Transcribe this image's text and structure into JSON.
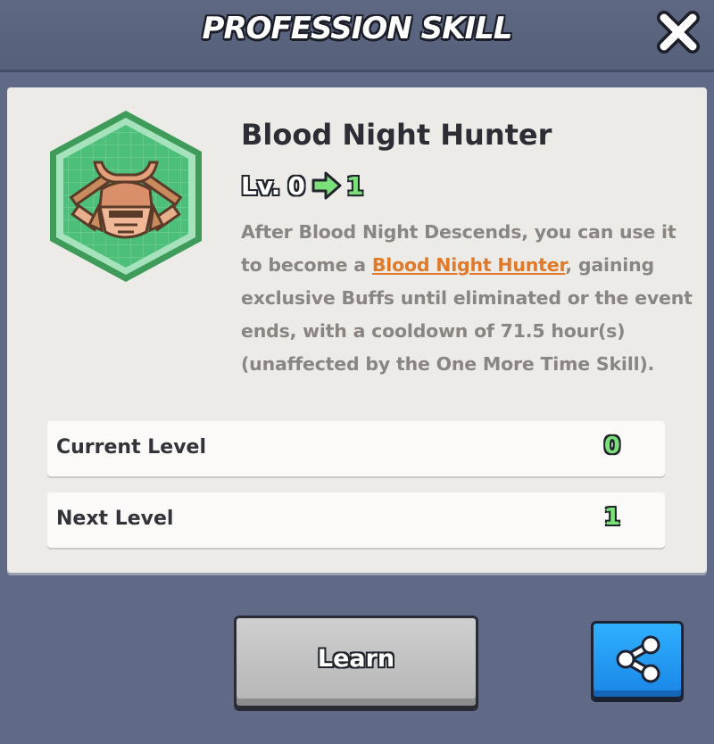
{
  "header": {
    "title": "PROFESSION SKILL",
    "close_icon": "close-icon"
  },
  "skill": {
    "icon": "samurai-helmet-icon",
    "name": "Blood Night Hunter",
    "level_prefix": "Lv.",
    "level_current": "0",
    "level_next": "1",
    "description_part1": "After Blood Night Descends, you can use it to become a ",
    "description_link": "Blood Night Hunter",
    "description_part2": ", gaining exclusive Buffs until eliminated or the event ends, with a cooldown of 71.5 hour(s) (unaffected by the One More Time Skill)."
  },
  "rows": [
    {
      "label": "Current Level",
      "value": "0"
    },
    {
      "label": "Next Level",
      "value": "1"
    }
  ],
  "actions": {
    "learn_label": "Learn",
    "share_icon": "share-icon"
  },
  "colors": {
    "background": "#606a86",
    "panel": "#ecebe8",
    "link": "#e07a2a",
    "level_green": "#7be07a",
    "share_blue": "#1a86e6"
  }
}
